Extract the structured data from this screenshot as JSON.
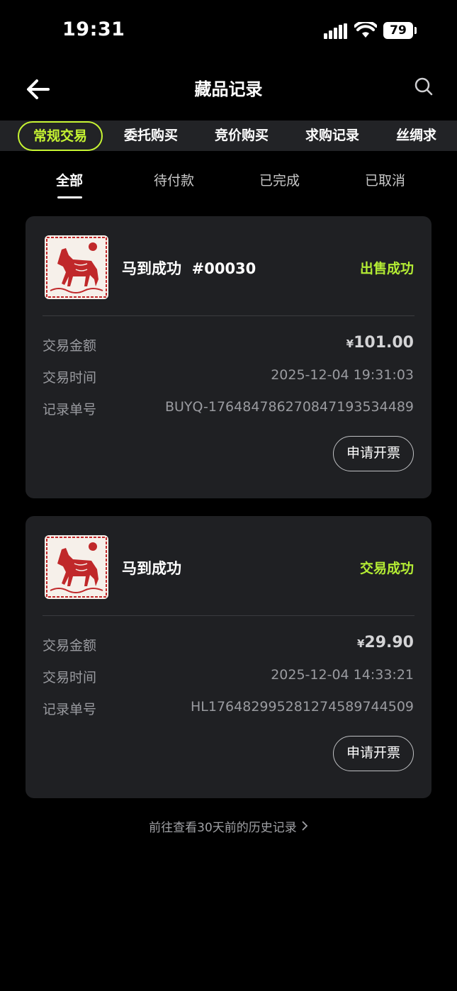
{
  "status_bar": {
    "time": "19:31",
    "battery": "79"
  },
  "nav": {
    "title": "藏品记录"
  },
  "top_tabs": [
    "常规交易",
    "委托购买",
    "竞价购买",
    "求购记录",
    "丝绸求"
  ],
  "sub_tabs": [
    "全部",
    "待付款",
    "已完成",
    "已取消"
  ],
  "labels": {
    "amount": "交易金额",
    "time": "交易时间",
    "order": "记录单号",
    "invoice": "申请开票",
    "currency": "¥"
  },
  "orders": [
    {
      "name": "马到成功  #00030",
      "status": "出售成功",
      "amount": "101.00",
      "time": "2025-12-04 19:31:03",
      "order_no": "BUYQ-1764847862708471935344​89"
    },
    {
      "name": "马到成功",
      "status": "交易成功",
      "amount": "29.90",
      "time": "2025-12-04 14:33:21",
      "order_no": "HL1764829952812745897445​09"
    }
  ],
  "history_link": "前往查看30天前的历史记录",
  "colors": {
    "accent": "#c6f432",
    "status_green": "#b4ec34",
    "card_bg": "#1f2023"
  }
}
